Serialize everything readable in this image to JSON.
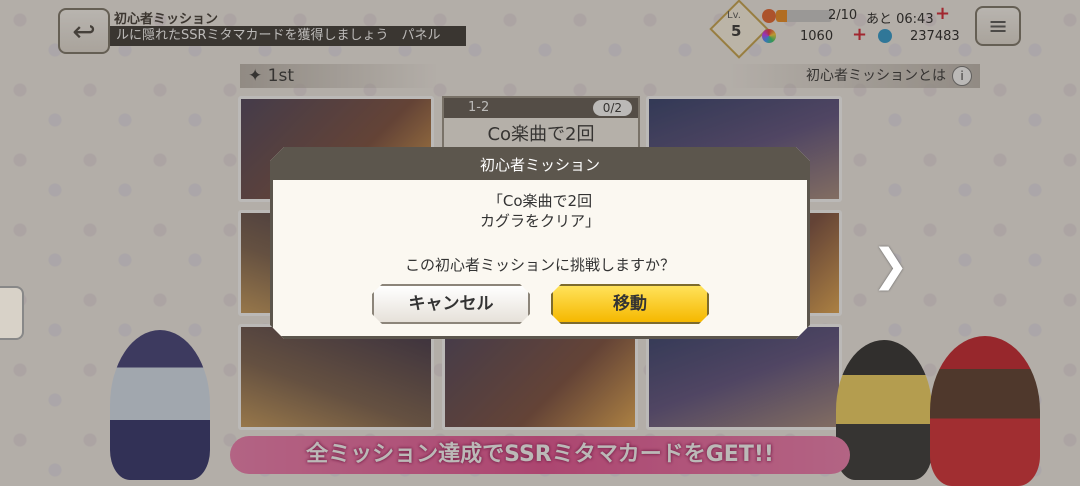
{
  "header": {
    "title": "初心者ミッション",
    "ticker": "ルに隠れたSSRミタマカードを獲得しましょう　パネル",
    "level_label": "Lv.",
    "level": "5",
    "stamina": "2/10",
    "stamina_fraction": 0.2,
    "timer": "あと 06:43",
    "currency1": "1060",
    "currency2": "237483"
  },
  "stage": {
    "label": "1st",
    "about": "初心者ミッションとは",
    "info": "i"
  },
  "mission_card": {
    "id": "1-2",
    "progress": "0/2",
    "text": "Co楽曲で2回"
  },
  "banner": "全ミッション達成でSSRミタマカードをGET!!",
  "dialog": {
    "title": "初心者ミッション",
    "line1": "「Co楽曲で2回",
    "line2": "カグラをクリア」",
    "question": "この初心者ミッションに挑戦しますか？",
    "cancel": "キャンセル",
    "confirm": "移動"
  },
  "colors": {
    "accent_yellow": "#f5b800",
    "banner_pink": "#e94f93",
    "dialog_border": "#5c564d"
  }
}
